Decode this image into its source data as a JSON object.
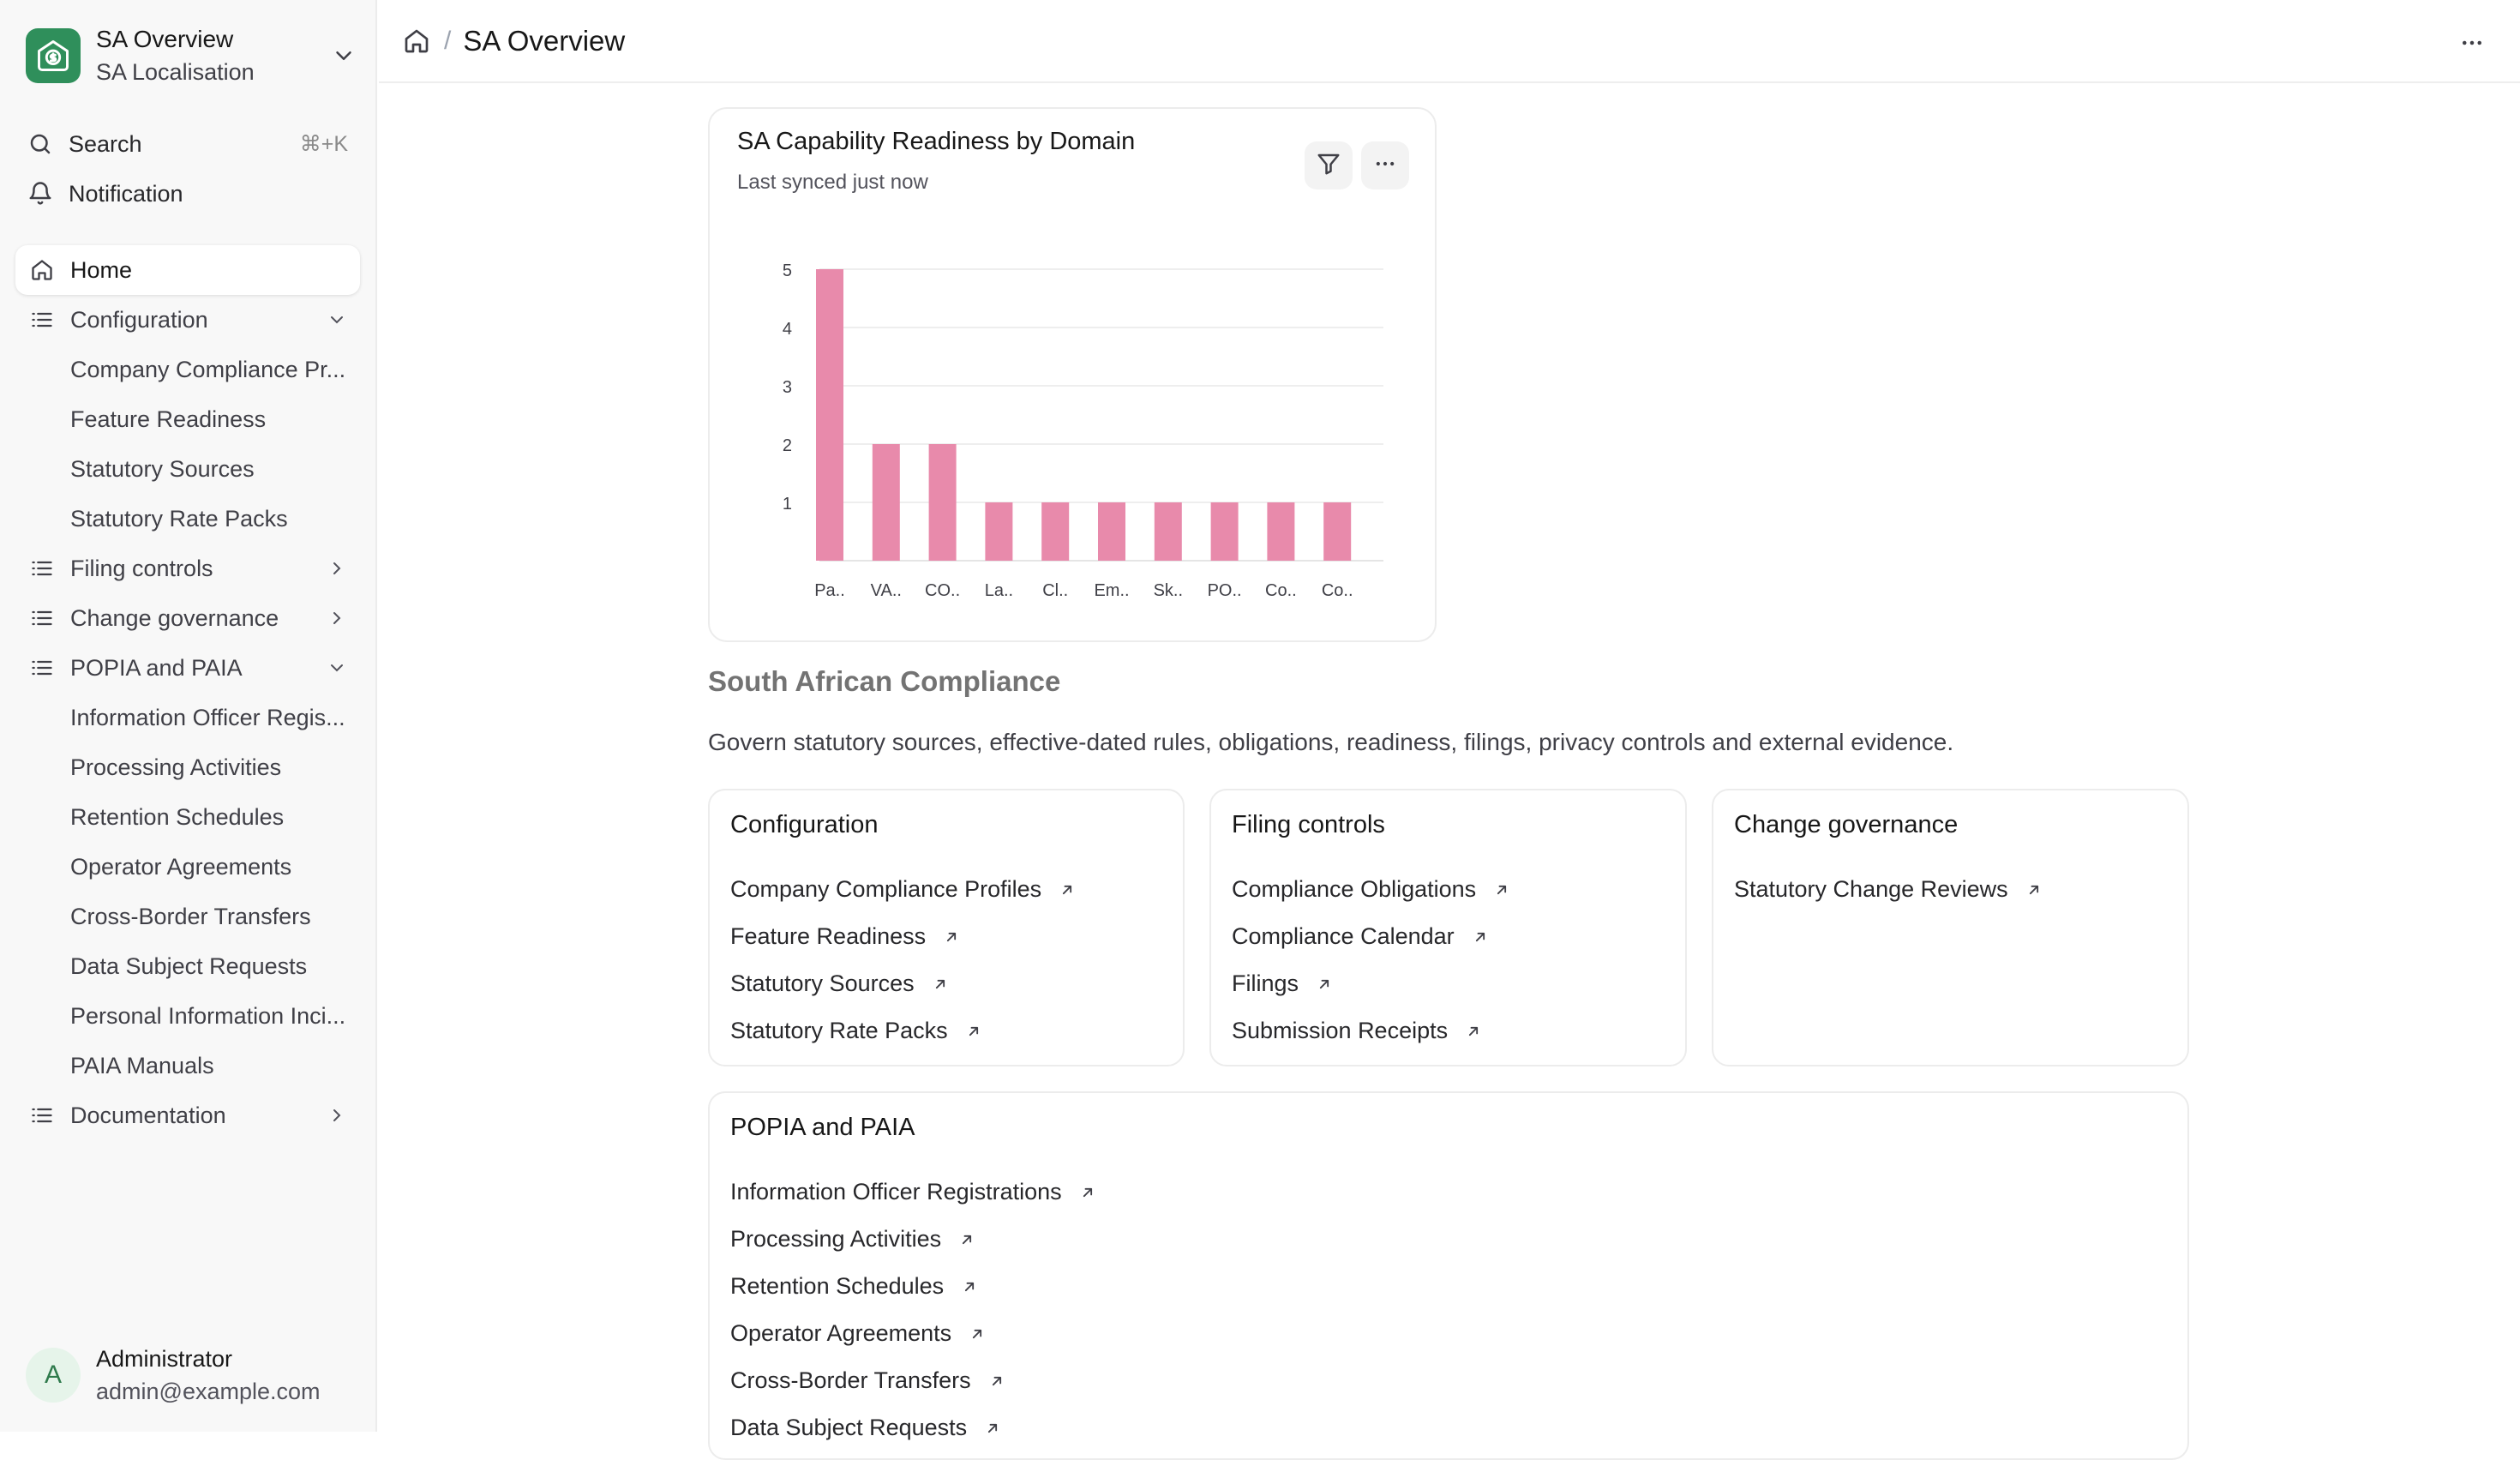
{
  "brand": {
    "title": "SA Overview",
    "subtitle": "SA Localisation"
  },
  "utility": {
    "search_label": "Search",
    "search_shortcut": "⌘+K",
    "notification_label": "Notification"
  },
  "nav": {
    "home": "Home",
    "configuration": "Configuration",
    "configuration_items": [
      "Company Compliance Pr...",
      "Feature Readiness",
      "Statutory Sources",
      "Statutory Rate Packs"
    ],
    "filing_controls": "Filing controls",
    "change_governance": "Change governance",
    "popia": "POPIA and PAIA",
    "popia_items": [
      "Information Officer Regis...",
      "Processing Activities",
      "Retention Schedules",
      "Operator Agreements",
      "Cross-Border Transfers",
      "Data Subject Requests",
      "Personal Information Inci...",
      "PAIA Manuals"
    ],
    "documentation": "Documentation"
  },
  "user": {
    "name": "Administrator",
    "email": "admin@example.com",
    "initial": "A"
  },
  "breadcrumb": {
    "separator": "/",
    "title": "SA Overview"
  },
  "chart_card": {
    "title": "SA Capability Readiness by Domain",
    "subtitle": "Last synced just now"
  },
  "chart_data": {
    "type": "bar",
    "categories": [
      "Pa..",
      "VA..",
      "CO..",
      "La..",
      "Cl..",
      "Em..",
      "Sk..",
      "PO..",
      "Co..",
      "Co.."
    ],
    "values": [
      5,
      2,
      2,
      1,
      1,
      1,
      1,
      1,
      1,
      1
    ],
    "yticks": [
      1,
      2,
      3,
      4,
      5
    ],
    "ylim": [
      0,
      5
    ],
    "grid": true,
    "bar_color": "#e88aab"
  },
  "section": {
    "title": "South African Compliance",
    "description": "Govern statutory sources, effective-dated rules, obligations, readiness, filings, privacy controls and external evidence."
  },
  "cards": {
    "configuration": {
      "title": "Configuration",
      "links": [
        "Company Compliance Profiles",
        "Feature Readiness",
        "Statutory Sources",
        "Statutory Rate Packs"
      ]
    },
    "filing": {
      "title": "Filing controls",
      "links": [
        "Compliance Obligations",
        "Compliance Calendar",
        "Filings",
        "Submission Receipts"
      ]
    },
    "change": {
      "title": "Change governance",
      "links": [
        "Statutory Change Reviews"
      ]
    },
    "popia": {
      "title": "POPIA and PAIA",
      "links": [
        "Information Officer Registrations",
        "Processing Activities",
        "Retention Schedules",
        "Operator Agreements",
        "Cross-Border Transfers",
        "Data Subject Requests"
      ]
    }
  }
}
